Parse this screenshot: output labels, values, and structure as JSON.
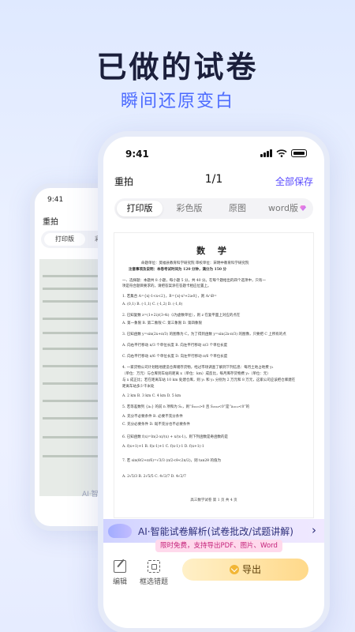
{
  "hero": {
    "title": "已做的试卷",
    "subtitle": "瞬间还原变白"
  },
  "bg_phone": {
    "time": "9:41",
    "title": "重拍",
    "tab_active": "打印版",
    "tab_second": "彩色",
    "ai_text": "AI·智能试卷"
  },
  "status_bar": {
    "time": "9:41"
  },
  "nav": {
    "left": "重拍",
    "pager": "1/1",
    "right": "全部保存"
  },
  "tabs": {
    "print": "打印版",
    "color": "彩色版",
    "original": "原图",
    "word": "word版"
  },
  "document": {
    "title": "数 学",
    "lines": [
      "命题单位：莫福县教育科学研究院    审校单位：宋明中教育科学研究院",
      "注意事项及说明：本卷考试时间为 120 分钟，满分为 150 分",
      "一、选择题：本题共 8 小题，每小题 5 分，共 40 分。在每个题给出的四个选项中，只有一",
      "   项是符合题目要求的，请把答案涂在答题卡相应位置上。",
      "1. 若集合 A={x|-1<x<2}，B={x|-x²+2≥0}，则 A∩B=",
      "   A. (0,1)          B. (-1,1)          C. (-1,2)          D. (-1,0)",
      "2. 已知复数 z=(1+2i)/(3-4i)（i为虚数单位），则 z 在复平面上对应的点在",
      "   A. 第一象限        B. 第二象限        C. 第三象限        D. 第四象限",
      "3. 已知函数 y=sin(2x+π/3) 的图像为 C，为了得到函数 y=sin(2x-π/3) 的图像，只要把 C 上所有的点",
      "   A. 向右平行移动 π/3 个单位长度        B. 向左平行移动 π/3 个单位长度",
      "   C. 向右平行移动 π/6 个单位长度        D. 向左平行移动 π/6 个单位长度",
      "4. 一家货物公司计划租地建造仓库储存货物，经过市场调查了解到下列信息：每月土地占地费 y₁",
      "   （单位：万元）与仓库到车站的距离 x（单位：km）成反比，每月库存货物费 y₂（单位：元）",
      "   与 x 成正比；若在距离车站 10 km 处建仓库，则 y₁ 和 y₂ 分别为 2 万元和 8 万元，这家公司应该把仓库建在",
      "   距离车站多少千米处",
      "   A. 2 km           B. 3 km           C. 4 km           D. 5 km",
      "5. 若等差数列 {aₙ} 的前 n 项和为 Sₙ，则“S₂₀₂₃>0 且 S₂₀₂₄<0”是“a₁₀₁₂<0”的",
      "   A. 充分不必要条件                    B. 必要不充分条件",
      "   C. 充分必要条件                      D. 既不充分也不必要条件",
      "6. 已知函数 f(x)=ln(2-x)/(x) + x/(x-1)，则下列函数是奇函数的是",
      "   A. f(x+1)+1       B. f(x-1)+1       C. f(x-1)-1       D. f(x+1)-1",
      "7. 若 sin(θ/2+π/6)=√3/3 (π/2<θ<2π/2)，则 tan2θ 的值为",
      "   A. 2√5/3          B. 2√5/5          C. 4√2/7          D. 4√2/7"
    ],
    "footer": "高三数学试卷  第 1 页  共 4 页"
  },
  "ai_banner": {
    "text": "AI·智能试卷解析(试卷批改/试题讲解)",
    "chevron": "›"
  },
  "promo": {
    "text": "限时免费，支持导出PDF、图片、Word"
  },
  "toolbar": {
    "edit": "编辑",
    "select_wrong": "框选错题",
    "export": "导出"
  },
  "colors": {
    "accent": "#5b4cff",
    "subtitle": "#4c6bff",
    "export_start": "#fff0c8",
    "export_end": "#ffd98a",
    "promo_text": "#c4237a"
  }
}
